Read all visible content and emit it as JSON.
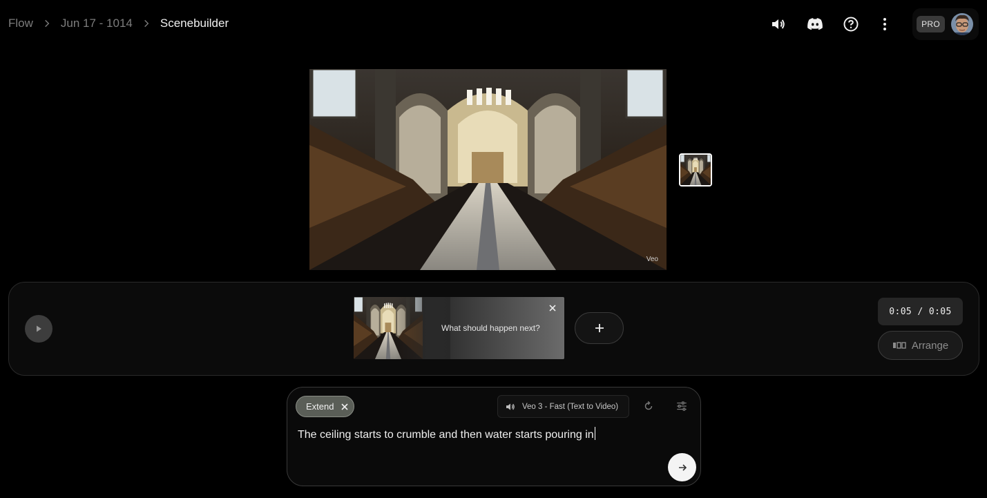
{
  "breadcrumb": {
    "items": [
      "Flow",
      "Jun 17 - 1014",
      "Scenebuilder"
    ]
  },
  "header": {
    "icons": [
      "volume-icon",
      "discord-icon",
      "help-icon",
      "more-vert-icon"
    ],
    "plan_badge": "PRO"
  },
  "video": {
    "watermark": "Veo"
  },
  "timeline": {
    "clip_prompt_placeholder": "What should happen next?",
    "time": "0:05 / 0:05",
    "arrange_label": "Arrange"
  },
  "composer": {
    "mode_chip": "Extend",
    "model_label": "Veo 3 - Fast (Text to Video)",
    "prompt_value": "The ceiling starts to crumble and then water starts pouring in"
  },
  "colors": {
    "background": "#000000",
    "panel": "#0b0b0b",
    "extend_chip": "#5a5e57",
    "muted_text": "#7d7d7d"
  }
}
